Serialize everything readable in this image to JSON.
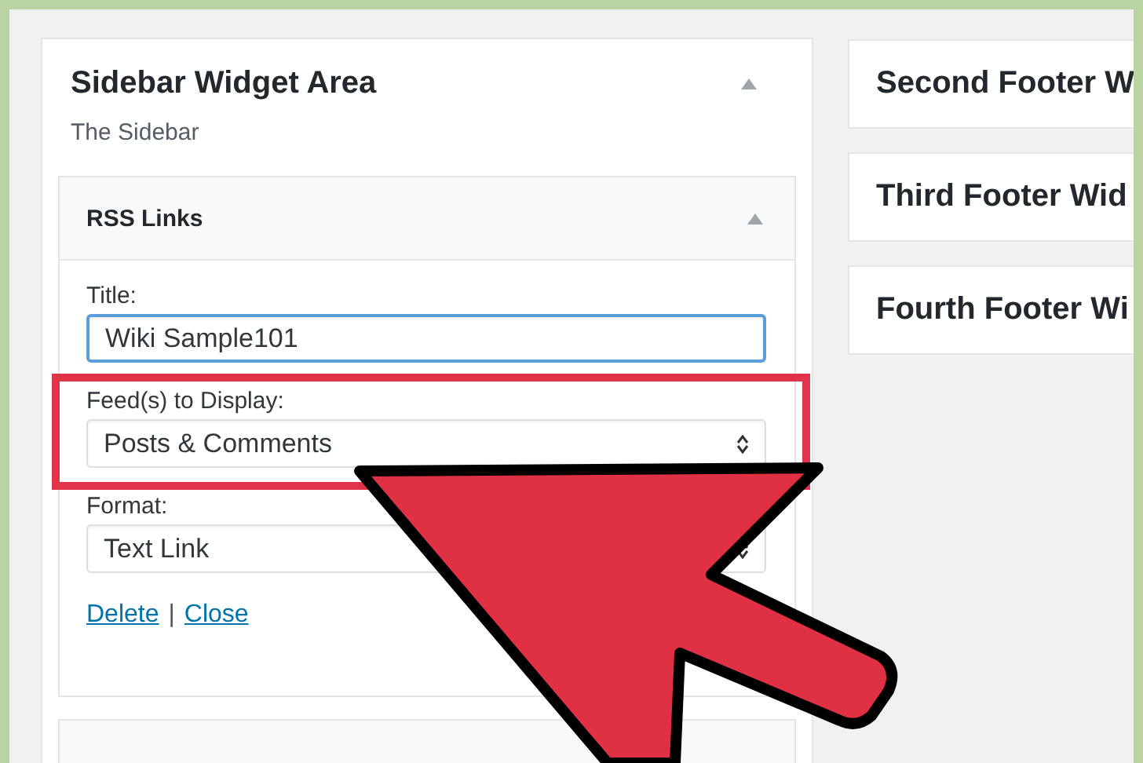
{
  "sidebar_area": {
    "title": "Sidebar Widget Area",
    "expanded": true,
    "description": "The Sidebar",
    "widgets": [
      {
        "title": "RSS Links",
        "expanded": true,
        "fields": [
          {
            "label": "Title:",
            "kind": "text",
            "value": "Wiki Sample101",
            "focused": true
          },
          {
            "label": "Feed(s) to Display:",
            "kind": "select",
            "value": "Posts & Comments",
            "focused": false
          },
          {
            "label": "Format:",
            "kind": "select",
            "value": "Text Link",
            "focused": false
          }
        ],
        "links": [
          "Delete",
          "Close"
        ],
        "link_separator": "|"
      }
    ]
  },
  "footer_areas": [
    {
      "title": "Second Footer W"
    },
    {
      "title": "Third Footer Wid"
    },
    {
      "title": "Fourth Footer Wi"
    }
  ]
}
